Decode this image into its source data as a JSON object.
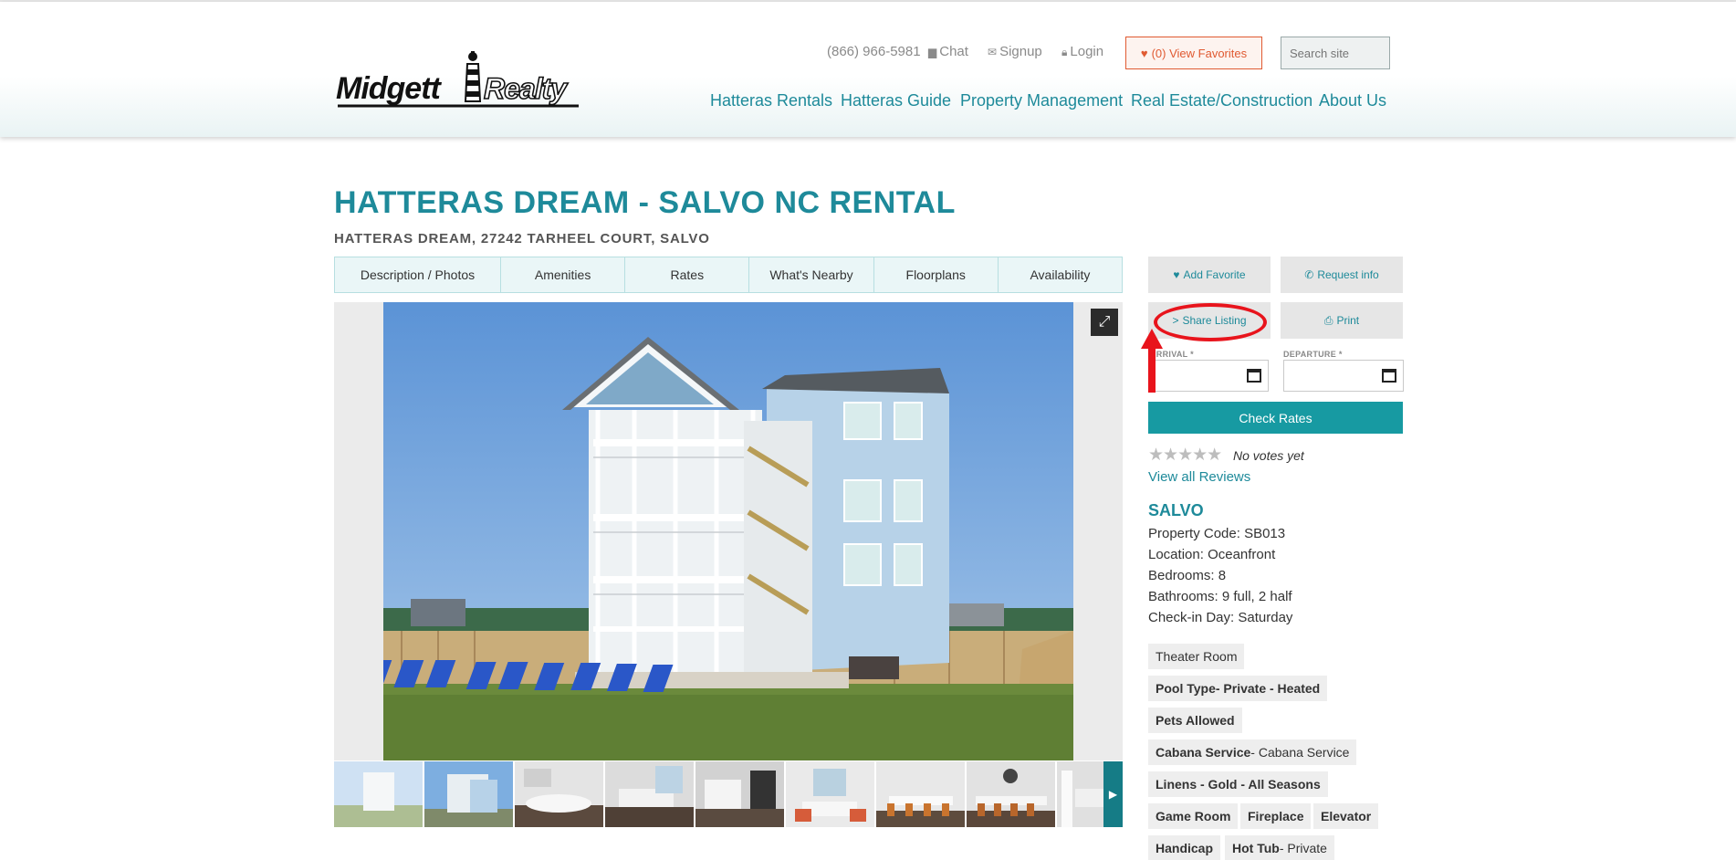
{
  "header": {
    "logo_text": "Midgett Realty",
    "phone": "(866) 966-5981",
    "chat": "Chat",
    "signup": "Signup",
    "login": "Login",
    "favorites": "(0) View Favorites",
    "search_placeholder": "Search site",
    "nav": [
      "Hatteras Rentals",
      "Hatteras Guide",
      "Property Management",
      "Real Estate/Construction",
      "About Us"
    ]
  },
  "page": {
    "title": "HATTERAS DREAM - SALVO NC RENTAL",
    "subtitle": "HATTERAS DREAM, 27242 TARHEEL COURT, SALVO",
    "tabs": [
      "Description / Photos",
      "Amenities",
      "Rates",
      "What's Nearby",
      "Floorplans",
      "Availability"
    ]
  },
  "sidebar": {
    "add_favorite": "Add Favorite",
    "request_info": "Request info",
    "share_listing": "Share Listing",
    "print": "Print",
    "arrival_label": "ARRIVAL *",
    "departure_label": "DEPARTURE *",
    "check_rates": "Check Rates",
    "rating_stars": 0,
    "no_votes": "No votes yet",
    "view_reviews": "View all Reviews",
    "area": "SALVO",
    "details": [
      {
        "label": "Property Code:",
        "value": "SB013"
      },
      {
        "label": "Location:",
        "value": "Oceanfront"
      },
      {
        "label": "Bedrooms:",
        "value": "8"
      },
      {
        "label": "Bathrooms:",
        "value": "9 full, 2 half"
      },
      {
        "label": "Check-in Day:",
        "value": "Saturday"
      }
    ],
    "amenities": [
      {
        "name": "Theater Room",
        "detail": ""
      },
      {
        "name": "Pool Type",
        "detail": " - Private - Heated",
        "bold_detail": true
      },
      {
        "name": "Pets Allowed",
        "detail": ""
      },
      {
        "name": "Cabana Service",
        "detail": " - Cabana Service"
      },
      {
        "name": "Linens - Gold - All Seasons",
        "detail": ""
      },
      {
        "name": "Game Room",
        "detail": ""
      },
      {
        "name": "Fireplace",
        "detail": ""
      },
      {
        "name": "Elevator",
        "detail": ""
      },
      {
        "name": "Handicap",
        "detail": ""
      },
      {
        "name": "Hot Tub",
        "detail": " - Private"
      }
    ]
  },
  "colors": {
    "teal": "#1e8a9a",
    "button_teal": "#179aa2",
    "favorites_orange": "#e05a32",
    "annotation_red": "#e8141c"
  }
}
